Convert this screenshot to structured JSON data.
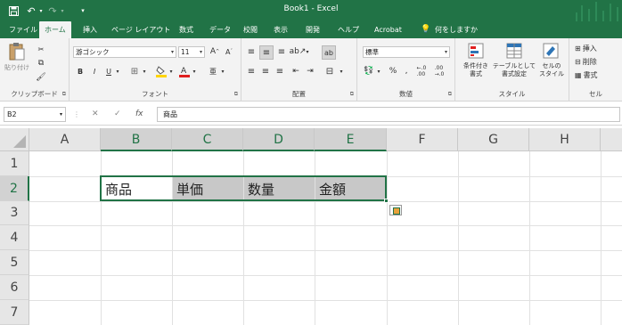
{
  "window": {
    "title": "Book1 - Excel"
  },
  "ribbon_tabs": [
    "ファイル",
    "ホーム",
    "挿入",
    "ページ レイアウト",
    "数式",
    "データ",
    "校閲",
    "表示",
    "開発",
    "ヘルプ",
    "Acrobat"
  ],
  "tell_me": "何をしますか",
  "groups": {
    "clipboard": {
      "label": "クリップボード",
      "paste": "貼り付け"
    },
    "font": {
      "label": "フォント",
      "font_name": "游ゴシック",
      "font_size": "11"
    },
    "alignment": {
      "label": "配置"
    },
    "number": {
      "label": "数値",
      "format": "標準"
    },
    "styles": {
      "label": "スタイル",
      "conditional": "条件付き\n書式",
      "table": "テーブルとして\n書式設定",
      "cell_styles": "セルの\nスタイル"
    },
    "cells": {
      "label": "セル",
      "insert": "挿入",
      "delete": "削除",
      "format": "書式"
    }
  },
  "formula_bar": {
    "name_box": "B2",
    "fx": "fx",
    "content": "商品"
  },
  "columns": [
    "A",
    "B",
    "C",
    "D",
    "E",
    "F",
    "G",
    "H"
  ],
  "rows": [
    "1",
    "2",
    "3",
    "4",
    "5",
    "6",
    "7"
  ],
  "cells": {
    "B2": "商品",
    "C2": "単価",
    "D2": "数量",
    "E2": "金額"
  },
  "colors": {
    "accent": "#217346",
    "header_fill": "#c8c8c8"
  }
}
